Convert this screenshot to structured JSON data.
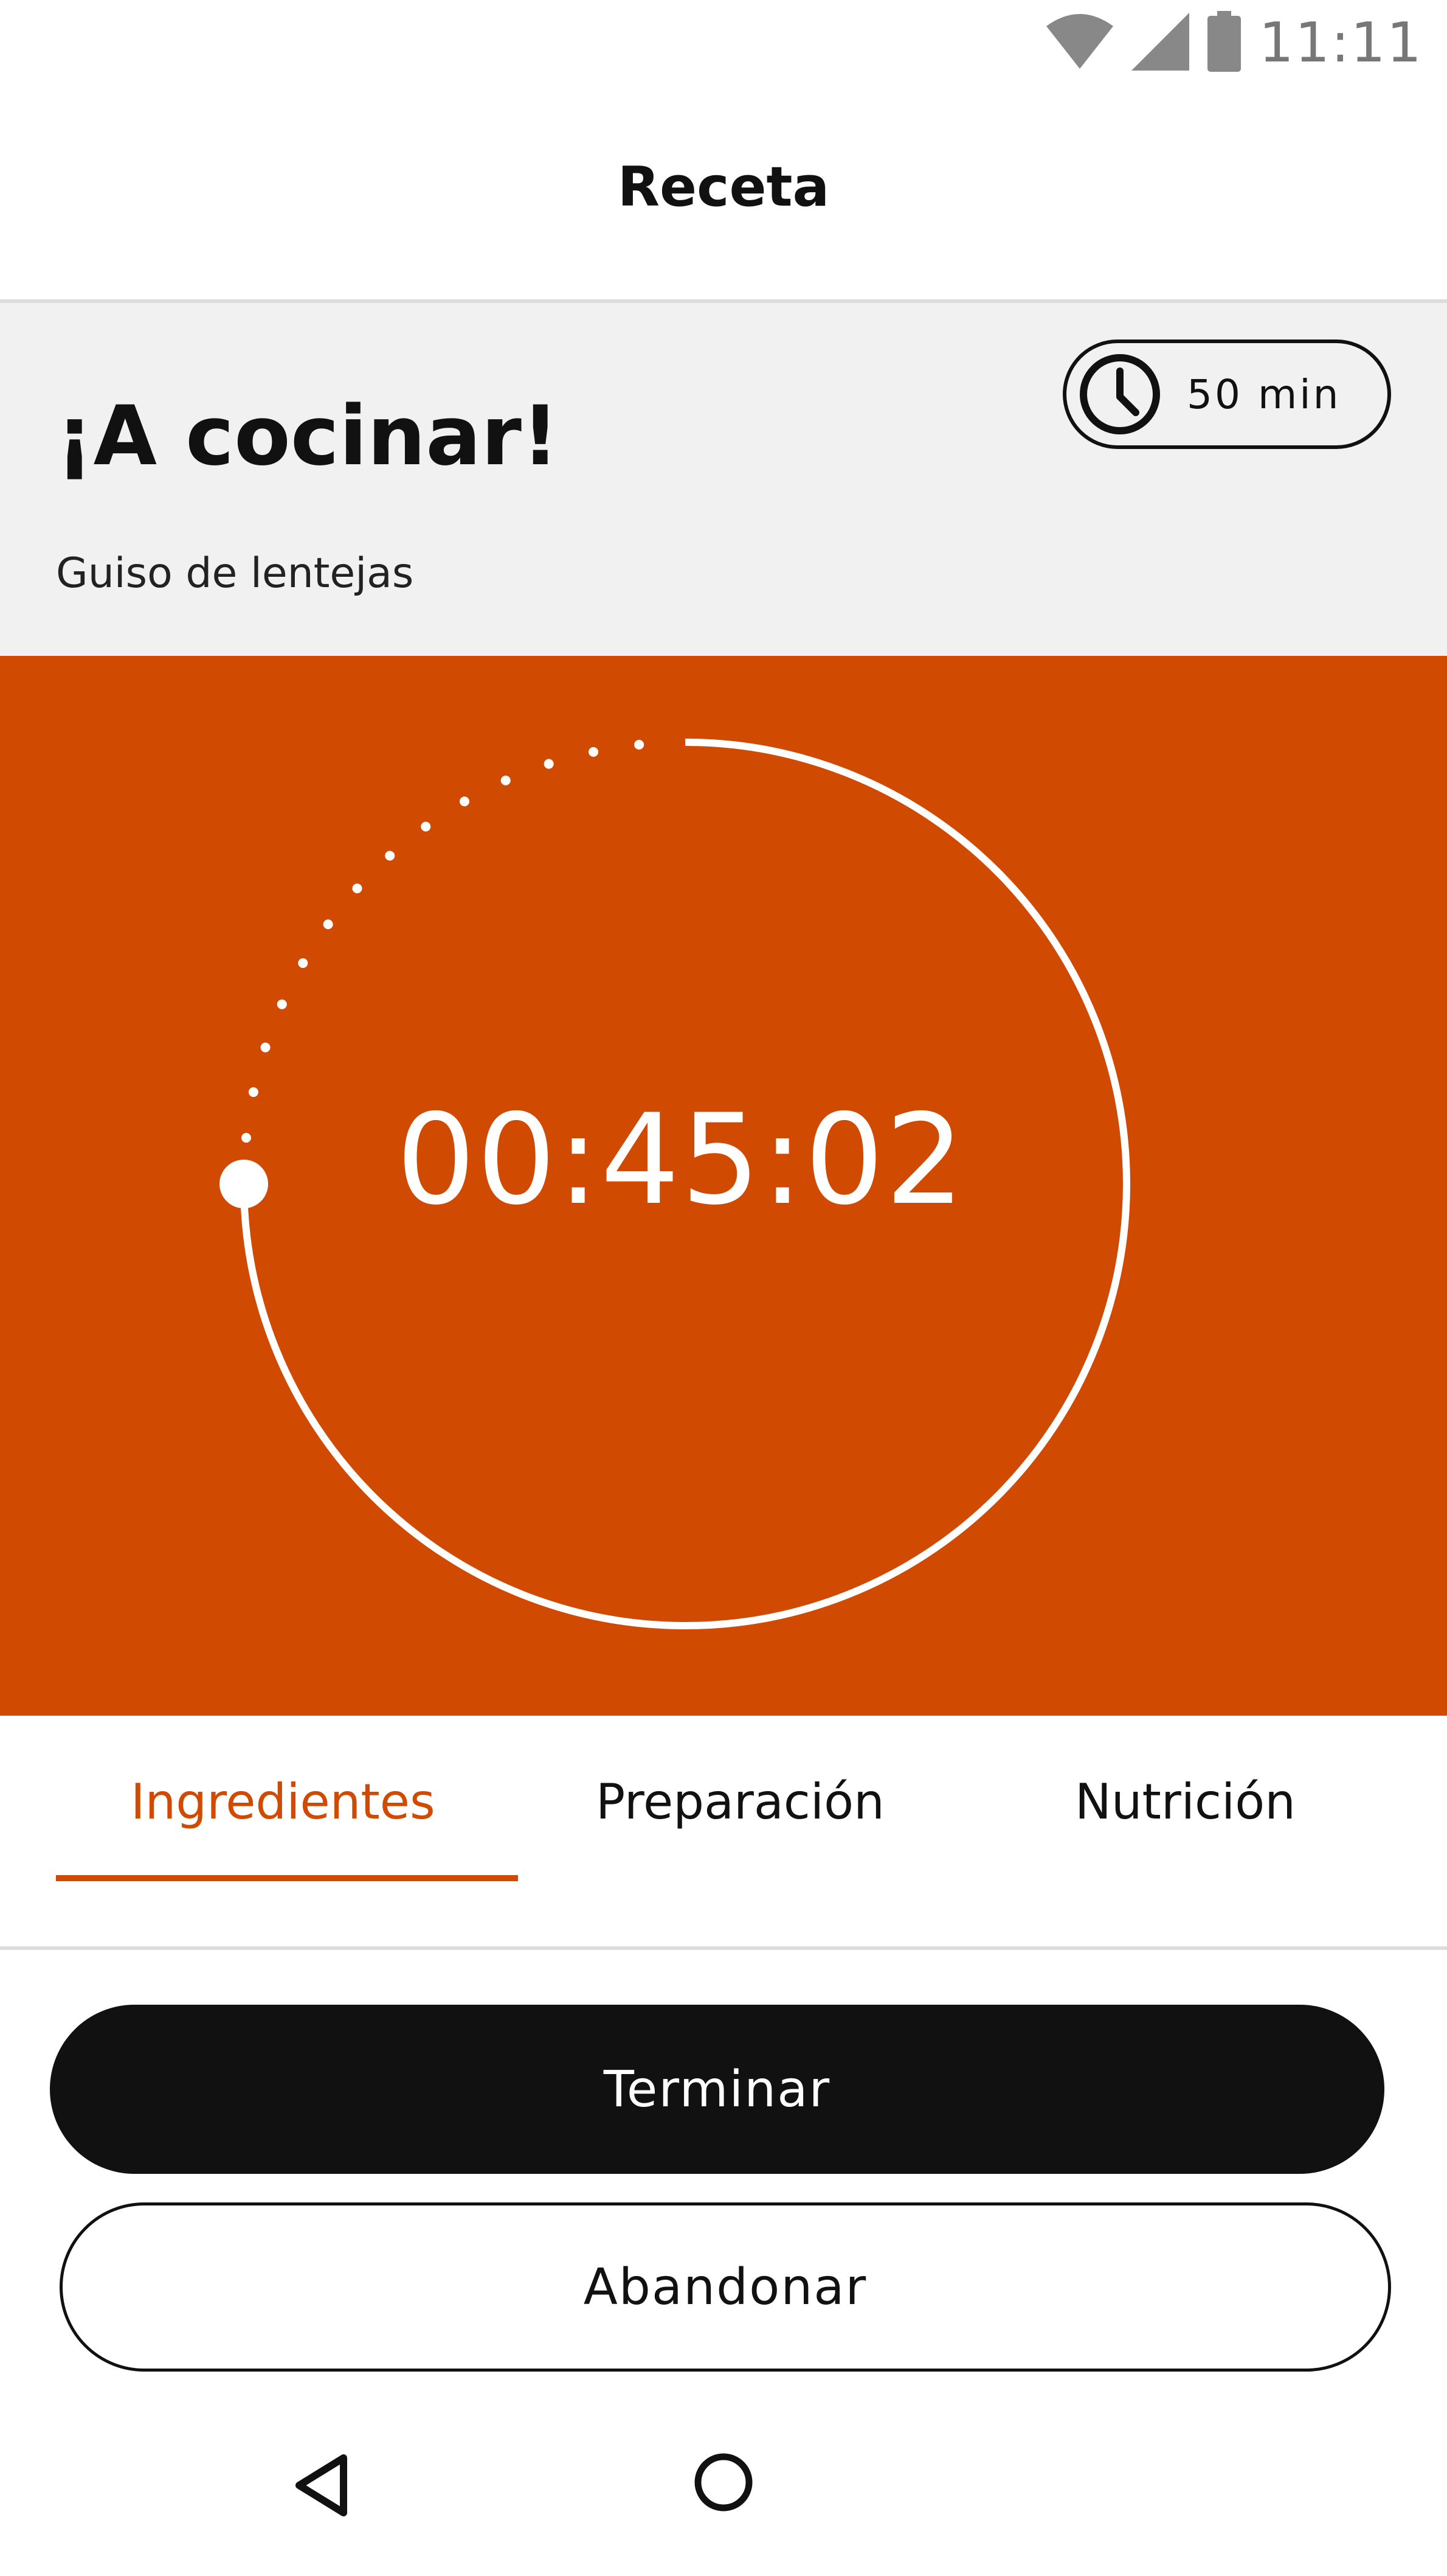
{
  "status_bar": {
    "time": "11:11",
    "icons": [
      "wifi-icon",
      "cell-signal-icon",
      "battery-icon"
    ]
  },
  "app_bar": {
    "title": "Receta"
  },
  "header": {
    "title": "¡A cocinar!",
    "subtitle": "Guiso de lentejas",
    "duration_label": "50 min",
    "duration_icon": "clock-icon"
  },
  "timer": {
    "display": "00:45:02",
    "progress_elapsed_fraction": 0.1
  },
  "tabs": [
    {
      "label": "Ingredientes",
      "active": true
    },
    {
      "label": "Preparación",
      "active": false
    },
    {
      "label": "Nutrición",
      "active": false
    }
  ],
  "actions": {
    "finish_label": "Terminar",
    "abandon_label": "Abandonar"
  },
  "navigation": {
    "icons": [
      "back-icon",
      "home-icon"
    ]
  },
  "colors": {
    "accent": "#d04a02",
    "primary_button": "#111111",
    "header_background": "#f1f1f1"
  }
}
